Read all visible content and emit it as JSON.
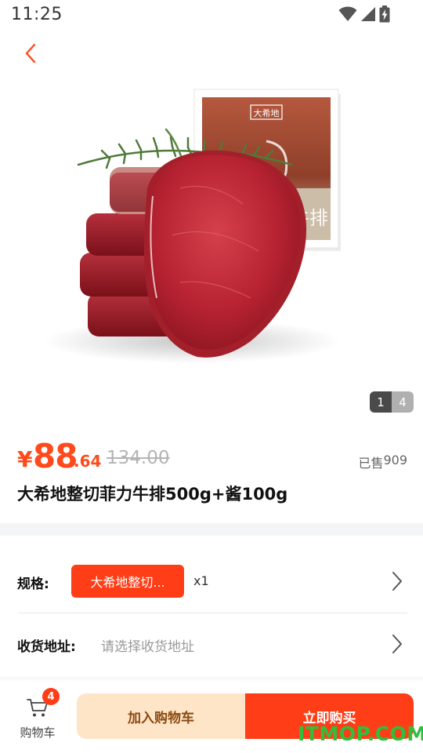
{
  "status_bar": {
    "time": "11:25",
    "icons": [
      "wifi-icon",
      "signal-icon",
      "battery-charging-icon"
    ]
  },
  "nav": {
    "back_icon": "chevron-left-icon",
    "accent_color": "#ff4a1c"
  },
  "gallery": {
    "current_page": "1",
    "total_pages": "4",
    "box_brand": "大希地",
    "box_text": "牛排"
  },
  "product": {
    "price_symbol": "¥",
    "price_int": "88",
    "price_decimal": ".64",
    "original_price": "134.00",
    "sold_label": "已售",
    "sold_count": "909",
    "title": "大希地整切菲力牛排500g+酱100g"
  },
  "spec": {
    "label": "规格:",
    "selected": "大希地整切...",
    "quantity": "x1"
  },
  "address": {
    "label": "收货地址:",
    "placeholder": "请选择收货地址"
  },
  "bottom_bar": {
    "cart_label": "购物车",
    "cart_badge": "4",
    "add_to_cart": "加入购物车",
    "buy_now": "立即购买"
  },
  "colors": {
    "price": "#ff4a1c",
    "primary_button": "#ff3d17",
    "secondary_button": "#ffe5c8",
    "secondary_button_text": "#8a4a12"
  },
  "watermark": "ITMOP.COM"
}
